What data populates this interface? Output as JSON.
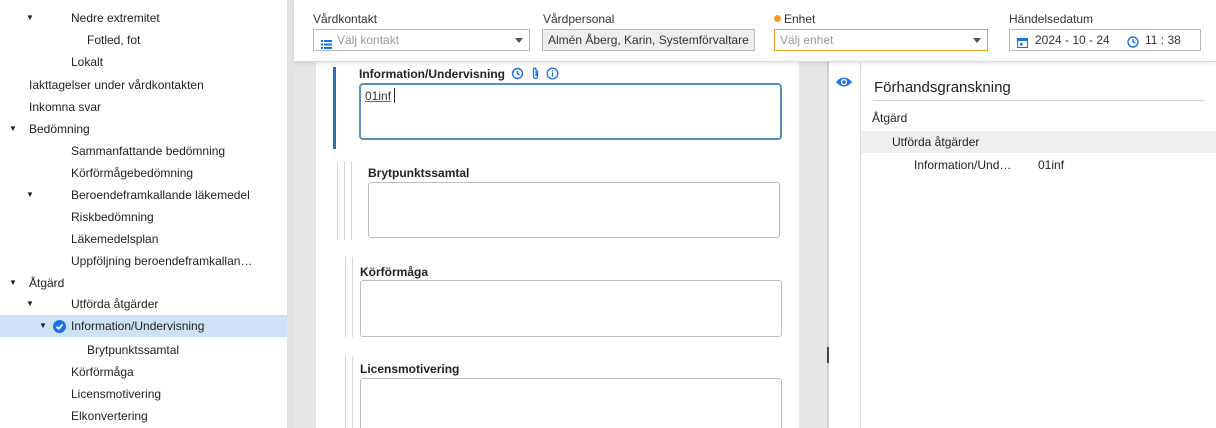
{
  "tree": {
    "items": [
      {
        "label": "Nedre extremitet",
        "expanded": true
      },
      {
        "label": "Fotled, fot"
      },
      {
        "label": "Lokalt"
      },
      {
        "label": "Iakttagelser under vårdkontakten"
      },
      {
        "label": "Inkomna svar"
      },
      {
        "label": "Bedömning",
        "expanded": true
      },
      {
        "label": "Sammanfattande bedömning"
      },
      {
        "label": "Körförmågebedömning"
      },
      {
        "label": "Beroendeframkallande läkemedel",
        "expanded": true
      },
      {
        "label": "Riskbedömning"
      },
      {
        "label": "Läkemedelsplan"
      },
      {
        "label": "Uppföljning beroendeframkallan…"
      },
      {
        "label": "Åtgärd",
        "expanded": true
      },
      {
        "label": "Utförda åtgärder",
        "expanded": true
      },
      {
        "label": "Information/Undervisning",
        "expanded": true,
        "selected": true,
        "completed": true
      },
      {
        "label": "Brytpunktssamtal"
      },
      {
        "label": "Körförmåga"
      },
      {
        "label": "Licensmotivering"
      },
      {
        "label": "Elkonvertering"
      }
    ]
  },
  "header": {
    "vardkontakt": {
      "label": "Vårdkontakt",
      "placeholder": "Välj kontakt"
    },
    "vardpersonal": {
      "label": "Vårdpersonal",
      "value": "Almén Åberg, Karin, Systemförvaltare"
    },
    "enhet": {
      "label": "Enhet",
      "placeholder": "Välj enhet",
      "required_color": "#f0a020"
    },
    "handelsedatum": {
      "label": "Händelsedatum",
      "date": "2024 - 10 - 24",
      "time": "11 : 38"
    }
  },
  "form": {
    "blocks": [
      {
        "label": "Information/Undervisning",
        "value": "01inf",
        "focused": true
      },
      {
        "label": "Brytpunktssamtal",
        "value": ""
      },
      {
        "label": "Körförmåga",
        "value": ""
      },
      {
        "label": "Licensmotivering",
        "value": ""
      }
    ]
  },
  "preview": {
    "title": "Förhandsgranskning",
    "section": "Åtgärd",
    "subsection": "Utförda åtgärder",
    "key": "Information/Und…",
    "value": "01inf"
  },
  "colors": {
    "accent": "#1a73e8",
    "selected_row": "#cfe1f5",
    "focus_border": "#5a8ec7"
  }
}
